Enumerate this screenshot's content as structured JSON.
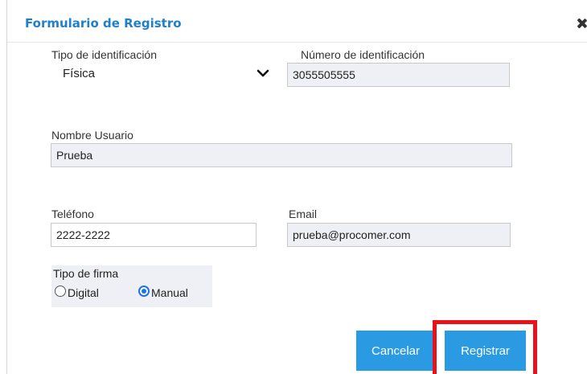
{
  "dialog": {
    "title": "Formulario de Registro"
  },
  "form": {
    "id_type": {
      "label": "Tipo de identificación",
      "value": "Física"
    },
    "id_number": {
      "label": "Número de identificación",
      "value": "3055505555"
    },
    "username": {
      "label": "Nombre Usuario",
      "value": "Prueba"
    },
    "phone": {
      "label": "Teléfono",
      "value": "2222-2222"
    },
    "email": {
      "label": "Email",
      "value": "prueba@procomer.com"
    },
    "signature_type": {
      "label": "Tipo de firma",
      "options": [
        "Digital",
        "Manual"
      ],
      "selected": "Manual"
    }
  },
  "buttons": {
    "cancel_label": "Cancelar",
    "register_label": "Registrar"
  },
  "colors": {
    "title": "#1f7fc9",
    "button": "#2a9be2",
    "highlight": "#e8121a",
    "field_bg": "#eef0f5"
  },
  "icons": {
    "close": "close-icon",
    "dropdown": "chevron-down-icon"
  }
}
